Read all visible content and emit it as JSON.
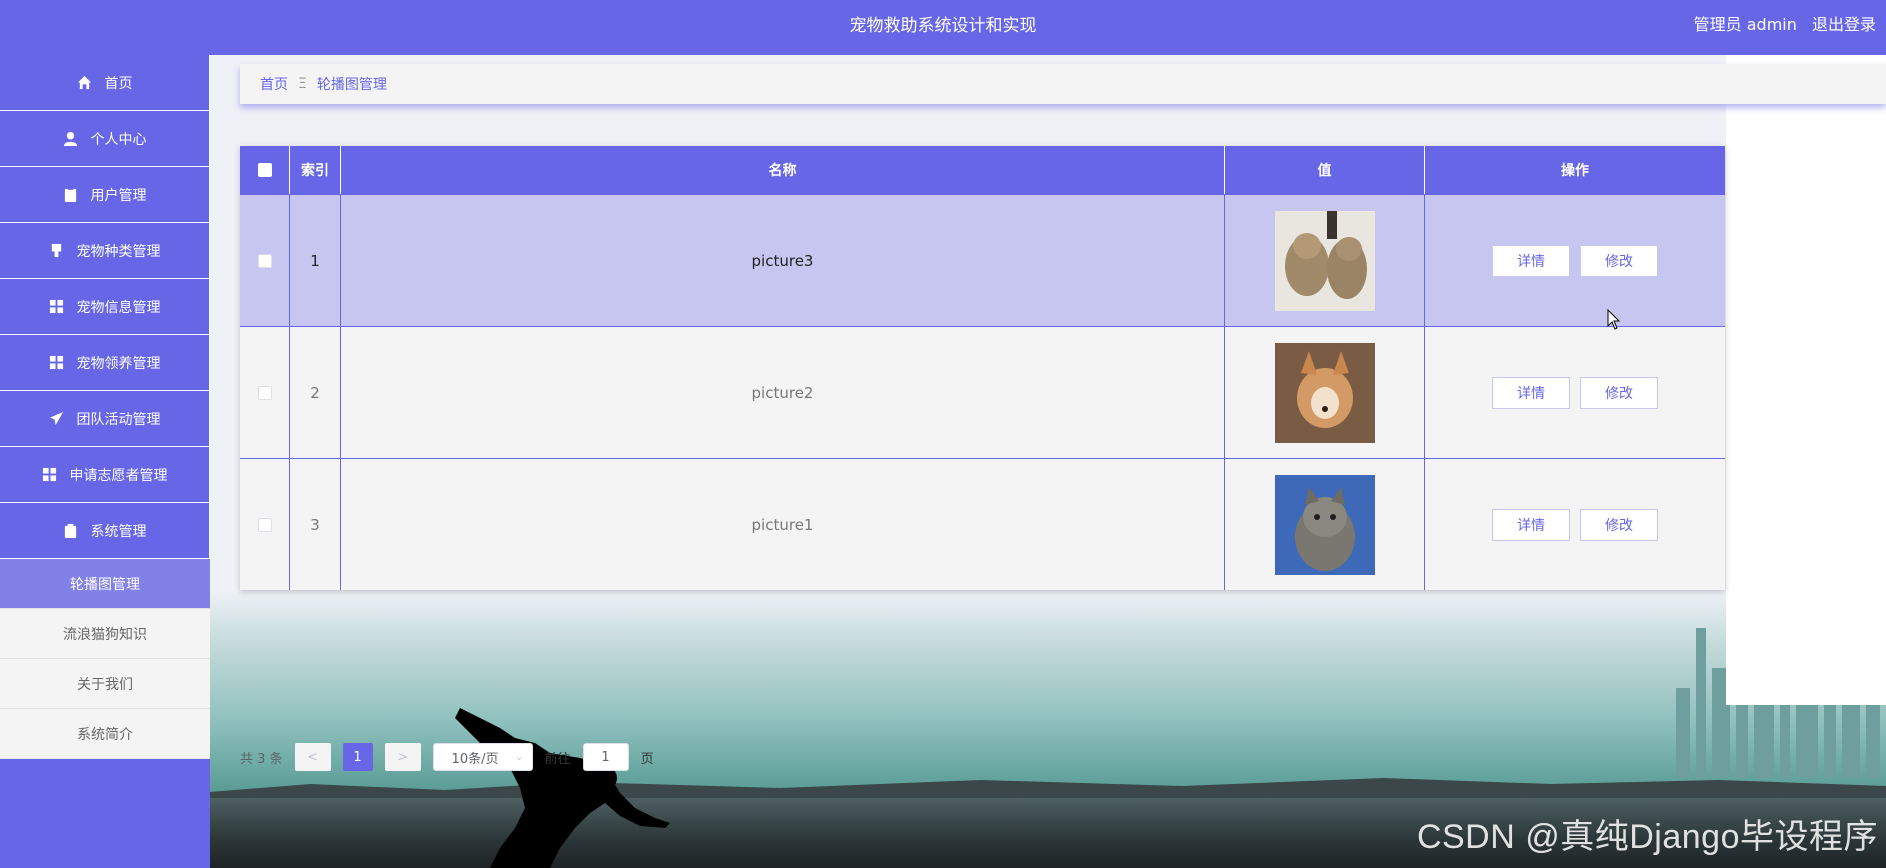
{
  "header": {
    "title": "宠物救助系统设计和实现",
    "user_label": "管理员 admin",
    "logout_label": "退出登录"
  },
  "sidebar": {
    "items": [
      {
        "label": "首页",
        "icon": "home-icon"
      },
      {
        "label": "个人中心",
        "icon": "user-icon"
      },
      {
        "label": "用户管理",
        "icon": "clipboard-icon"
      },
      {
        "label": "宠物种类管理",
        "icon": "brush-icon"
      },
      {
        "label": "宠物信息管理",
        "icon": "grid-icon"
      },
      {
        "label": "宠物领养管理",
        "icon": "grid-icon"
      },
      {
        "label": "团队活动管理",
        "icon": "paper-plane-icon"
      },
      {
        "label": "申请志愿者管理",
        "icon": "grid-icon"
      },
      {
        "label": "系统管理",
        "icon": "briefcase-icon"
      }
    ],
    "sub_items": [
      {
        "label": "轮播图管理",
        "active": true
      },
      {
        "label": "流浪猫狗知识",
        "active": false
      },
      {
        "label": "关于我们",
        "active": false
      },
      {
        "label": "系统简介",
        "active": false
      }
    ]
  },
  "breadcrumb": {
    "home": "首页",
    "separator": "Ξ",
    "current": "轮播图管理"
  },
  "table": {
    "headers": [
      "索引",
      "名称",
      "值",
      "操作"
    ],
    "rows": [
      {
        "index": "1",
        "name": "picture3",
        "image": "two-kittens-photo",
        "highlighted": true
      },
      {
        "index": "2",
        "name": "picture2",
        "image": "corgi-puppy-photo",
        "highlighted": false
      },
      {
        "index": "3",
        "name": "picture1",
        "image": "grey-cat-photo",
        "highlighted": false
      }
    ],
    "detail_label": "详情",
    "edit_label": "修改"
  },
  "pagination": {
    "total_text": "共 3 条",
    "prev": "<",
    "next": ">",
    "current_page": "1",
    "page_size": "10条/页",
    "goto_label": "前往",
    "goto_value": "1",
    "page_suffix": "页"
  },
  "watermark": "CSDN @真纯Django毕设程序",
  "colors": {
    "primary": "#6666e6",
    "row_highlight": "#c6c6f1"
  }
}
